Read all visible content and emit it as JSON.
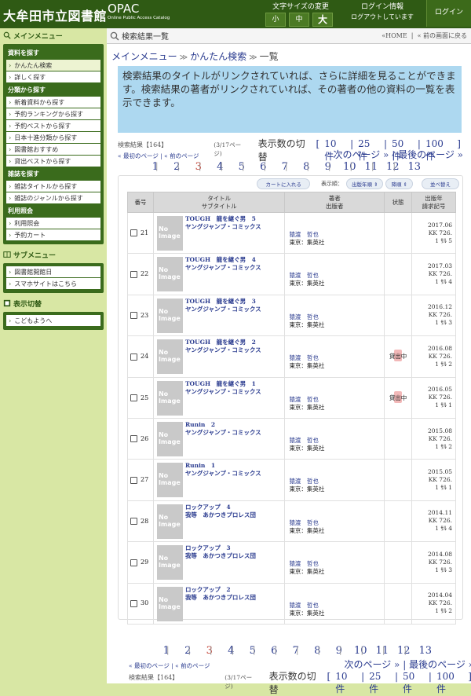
{
  "header": {
    "site_title": "大牟田市立図書館",
    "opac_big": "OPAC",
    "opac_small": "Online Public Access Catalog",
    "fontsize_label": "文字サイズの変更",
    "fontsize_small": "小",
    "fontsize_medium": "中",
    "fontsize_large": "大",
    "login_info_label": "ログイン情報",
    "login_status": "ログアウトしています",
    "login_button": "ログイン"
  },
  "sidebar": {
    "main_menu_label": "メインメニュー",
    "sections": [
      {
        "category": "資料を探す",
        "items": [
          "かんたん検索",
          "詳しく探す"
        ]
      },
      {
        "category": "分類から探す",
        "items": [
          "新着資料から探す",
          "予約ランキングから探す",
          "予約ベストから探す",
          "日本十進分類から探す",
          "図書館おすすめ",
          "貸出ベストから探す"
        ]
      },
      {
        "category": "雑誌を探す",
        "items": [
          "雑誌タイトルから探す",
          "雑誌のジャンルから探す"
        ]
      },
      {
        "category": "利用照会",
        "items": [
          "利用照会",
          "予約カート"
        ]
      }
    ],
    "sub_menu_label": "サブメニュー",
    "sub_items": [
      "図書館開館日",
      "スマホサイトはこちら"
    ],
    "display_label": "表示切替",
    "display_items": [
      "こどもようへ"
    ]
  },
  "main": {
    "page_title": "検索結果一覧",
    "home_link": "«HOME",
    "back_link": "« 前の画面に戻る",
    "breadcrumb": {
      "menu": "メインメニュー",
      "simple": "かんたん検索",
      "current": "一覧"
    },
    "info_text": "検索結果のタイトルがリンクされていれば、さらに詳細を見ることができます。検索結果の著者がリンクされていれば、その著者の他の資料の一覧を表示できます。",
    "result_count": "検索結果【164】",
    "page_of": "(3/17ページ)",
    "display_switch": "表示数の切替",
    "display_options": [
      "10件",
      "25件",
      "50件",
      "100件"
    ],
    "first_page": "« 最初のページ",
    "prev_page": "« 前のページ",
    "next_page": "次のページ »",
    "last_page": "最後のページ »",
    "pages": [
      "1",
      "2",
      "3",
      "4",
      "5",
      "6",
      "7",
      "8",
      "9",
      "10",
      "11",
      "12",
      "13"
    ],
    "current_page": "3",
    "controls": {
      "cart": "カートに入れる",
      "order_label": "表示順：",
      "order_value": "出版年順",
      "dir_value": "降順",
      "sort_button": "並べ替え"
    },
    "table_headers": {
      "num": "番号",
      "title": "タイトル",
      "subtitle": "サブタイトル",
      "author": "著者",
      "publisher": "出版者",
      "status": "状態",
      "call1": "出版年",
      "call2": "請求記号"
    },
    "rows": [
      {
        "num": "21",
        "title": "TOUGH　龍を継ぐ男　5",
        "series": "ヤングジャンプ・コミックス",
        "author": "猿渡　哲也",
        "pub": "東京：集英社",
        "status": "",
        "call1": "2017.06",
        "call2": "KK 726.",
        "call3": "1 ｻﾙ 5"
      },
      {
        "num": "22",
        "title": "TOUGH　龍を継ぐ男　4",
        "series": "ヤングジャンプ・コミックス",
        "author": "猿渡　哲也",
        "pub": "東京：集英社",
        "status": "",
        "call1": "2017.03",
        "call2": "KK 726.",
        "call3": "1 ｻﾙ 4"
      },
      {
        "num": "23",
        "title": "TOUGH　龍を継ぐ男　3",
        "series": "ヤングジャンプ・コミックス",
        "author": "猿渡　哲也",
        "pub": "東京：集英社",
        "status": "",
        "call1": "2016.12",
        "call2": "KK 726.",
        "call3": "1 ｻﾙ 3"
      },
      {
        "num": "24",
        "title": "TOUGH　龍を継ぐ男　2",
        "series": "ヤングジャンプ・コミックス",
        "author": "猿渡　哲也",
        "pub": "東京：集英社",
        "status": "貸出中",
        "call1": "2016.08",
        "call2": "KK 726.",
        "call3": "1 ｻﾙ 2"
      },
      {
        "num": "25",
        "title": "TOUGH　龍を継ぐ男　1",
        "series": "ヤングジャンプ・コミックス",
        "author": "猿渡　哲也",
        "pub": "東京：集英社",
        "status": "貸出中",
        "call1": "2016.05",
        "call2": "KK 726.",
        "call3": "1 ｻﾙ 1"
      },
      {
        "num": "26",
        "title": "Runin　2",
        "series": "ヤングジャンプ・コミックス",
        "author": "猿渡　哲也",
        "pub": "東京：集英社",
        "status": "",
        "call1": "2015.08",
        "call2": "KK 726.",
        "call3": "1 ｻﾙ 2"
      },
      {
        "num": "27",
        "title": "Runin　1",
        "series": "ヤングジャンプ・コミックス",
        "author": "猿渡　哲也",
        "pub": "東京：集英社",
        "status": "",
        "call1": "2015.05",
        "call2": "KK 726.",
        "call3": "1 ｻﾙ 1"
      },
      {
        "num": "28",
        "title": "ロックアップ　4",
        "series": "我等　あかつきプロレス団",
        "author": "猿渡　哲也",
        "pub": "東京：集英社",
        "status": "",
        "call1": "2014.11",
        "call2": "KK 726.",
        "call3": "1 ｻﾙ 4"
      },
      {
        "num": "29",
        "title": "ロックアップ　3",
        "series": "我等　あかつきプロレス団",
        "author": "猿渡　哲也",
        "pub": "東京：集英社",
        "status": "",
        "call1": "2014.08",
        "call2": "KK 726.",
        "call3": "1 ｻﾙ 3"
      },
      {
        "num": "30",
        "title": "ロックアップ　2",
        "series": "我等　あかつきプロレス団",
        "author": "猿渡　哲也",
        "pub": "東京：集英社",
        "status": "",
        "call1": "2014.04",
        "call2": "KK 726.",
        "call3": "1 ｻﾙ 2"
      }
    ],
    "no_image_1": "No",
    "no_image_2": "Image"
  }
}
